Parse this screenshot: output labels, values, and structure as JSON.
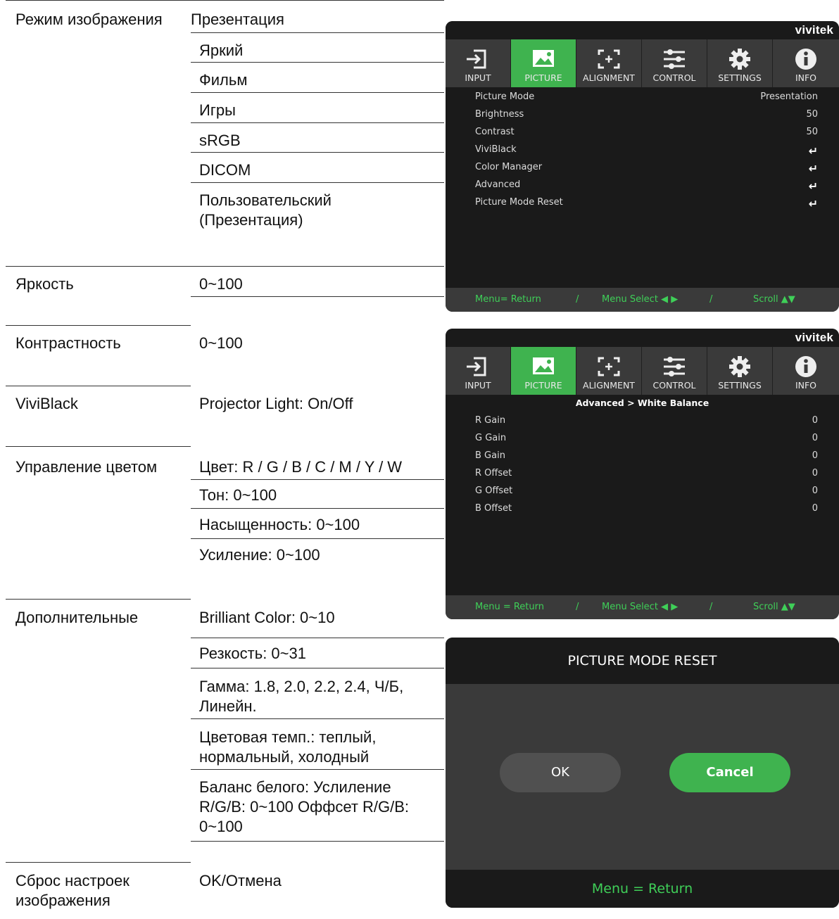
{
  "table": {
    "picture_mode": {
      "label": "Режим изображения",
      "options": [
        "Презентация",
        "Яркий",
        "Фильм",
        "Игры",
        "sRGB",
        "DICOM",
        "Пользовательский (Презентация)"
      ]
    },
    "brightness": {
      "label": "Яркость",
      "value": "0~100"
    },
    "contrast": {
      "label": "Контрастность",
      "value": "0~100"
    },
    "viviblack": {
      "label": "ViviBlack",
      "value": "Projector Light: On/Off"
    },
    "color_manager": {
      "label": "Управление цветом",
      "values": [
        "Цвет: R / G / B / C / M / Y / W",
        "Тон: 0~100",
        "Насыщенность: 0~100",
        "Усиление: 0~100"
      ]
    },
    "advanced": {
      "label": "Дополнительные",
      "values": [
        "Brilliant Color: 0~10",
        "Резкость: 0~31",
        "Гамма: 1.8, 2.0, 2.2, 2.4, Ч/Б, Линейн.",
        "Цветовая темп.: теплый, нормальный, холодный",
        "Баланс белого: Услиление R/G/B: 0~100 Оффсет R/G/B: 0~100"
      ]
    },
    "reset": {
      "label": "Сброс настроек изображения",
      "value": "OK/Отмена"
    }
  },
  "osd": {
    "brand": "vivitek",
    "tabs": [
      "INPUT",
      "PICTURE",
      "ALIGNMENT",
      "CONTROL",
      "SETTINGS",
      "INFO"
    ],
    "active_tab": "PICTURE",
    "accent_color": "#3fb34f",
    "menu1": {
      "rows": [
        {
          "key": "Picture Mode",
          "value": "Presentation"
        },
        {
          "key": "Brightness",
          "value": "50"
        },
        {
          "key": "Contrast",
          "value": "50"
        },
        {
          "key": "ViviBlack",
          "value": "↵"
        },
        {
          "key": "Color Manager",
          "value": "↵"
        },
        {
          "key": "Advanced",
          "value": "↵"
        },
        {
          "key": "Picture Mode Reset",
          "value": "↵"
        }
      ],
      "footer": [
        "Menu= Return",
        "/",
        "Menu Select ◀ ▶",
        "/",
        "Scroll ▲▼"
      ]
    },
    "menu2": {
      "subtitle": "Advanced > White Balance",
      "rows": [
        {
          "key": "R Gain",
          "value": "0"
        },
        {
          "key": "G Gain",
          "value": "0"
        },
        {
          "key": "B Gain",
          "value": "0"
        },
        {
          "key": "R Offset",
          "value": "0"
        },
        {
          "key": "G Offset",
          "value": "0"
        },
        {
          "key": "B Offset",
          "value": "0"
        }
      ],
      "footer": [
        "Menu = Return",
        "/",
        "Menu Select ◀ ▶",
        "/",
        "Scroll ▲▼"
      ]
    },
    "dialog": {
      "title": "PICTURE MODE RESET",
      "ok": "OK",
      "cancel": "Cancel",
      "footer": "Menu = Return"
    }
  }
}
